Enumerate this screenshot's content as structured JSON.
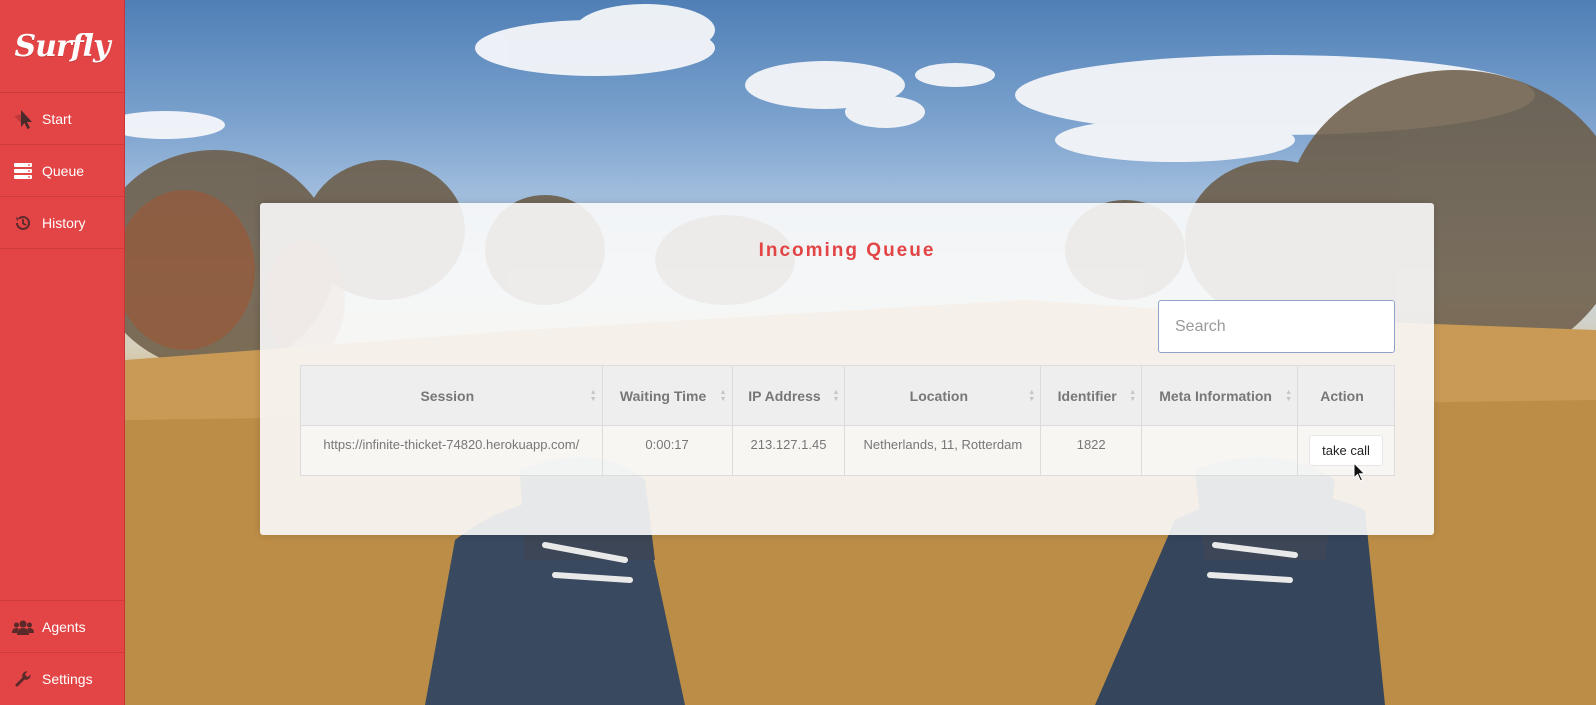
{
  "sidebar": {
    "logo": "Surfly",
    "nav": [
      {
        "label": "Start",
        "icon": "cursor-arrow-icon"
      },
      {
        "label": "Queue",
        "icon": "server-stack-icon"
      },
      {
        "label": "History",
        "icon": "history-icon"
      }
    ],
    "bottom_nav": [
      {
        "label": "Agents",
        "icon": "users-icon"
      },
      {
        "label": "Settings",
        "icon": "wrench-icon"
      }
    ],
    "active": "Queue"
  },
  "panel": {
    "title": "Incoming Queue",
    "search": {
      "placeholder": "Search",
      "value": ""
    },
    "table": {
      "columns": [
        "Session",
        "Waiting Time",
        "IP Address",
        "Location",
        "Identifier",
        "Meta Information",
        "Action"
      ],
      "rows": [
        {
          "session": "https://infinite-thicket-74820.herokuapp.com/",
          "waiting_time": "0:00:17",
          "ip_address": "213.127.1.45",
          "location": "Netherlands, 11, Rotterdam",
          "identifier": "1822",
          "meta_information": "",
          "action_label": "take call"
        }
      ]
    }
  },
  "colors": {
    "brand": "#e34445",
    "title": "#e34445"
  }
}
